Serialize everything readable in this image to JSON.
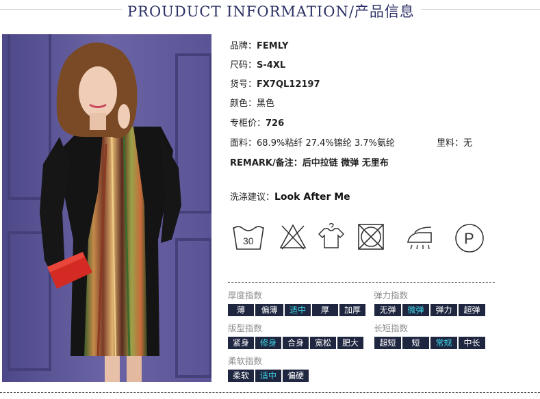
{
  "header": {
    "title": "PROUDUCT INFORMATION/产品信息"
  },
  "info": {
    "brand": {
      "label": "品牌：",
      "value": "FEMLY"
    },
    "size": {
      "label": "尺码：",
      "value": "S-4XL"
    },
    "sku": {
      "label": "货号：",
      "value": "FX7QL12197"
    },
    "color": {
      "label": "颜色：",
      "value": "黑色"
    },
    "price": {
      "label": "专柜价：",
      "value": "726"
    },
    "fabric": {
      "label": "面料：",
      "value": "68.9%粘纤 27.4%锦纶 3.7%氨纶"
    },
    "lining": {
      "label": "里料：",
      "value": "无"
    },
    "remark": {
      "label": "REMARK/备注：",
      "value": "后中拉链 微弹 无里布"
    },
    "wash": {
      "label": "洗涤建议：",
      "value": "Look After Me"
    }
  },
  "care_icons": [
    {
      "name": "wash-30-icon",
      "text": "30"
    },
    {
      "name": "no-bleach-icon"
    },
    {
      "name": "hang-dry-icon"
    },
    {
      "name": "no-tumble-dry-icon"
    },
    {
      "name": "iron-icon"
    },
    {
      "name": "dry-clean-p-icon",
      "text": "P"
    }
  ],
  "indices": {
    "thickness": {
      "title": "厚度指数",
      "options": [
        "薄",
        "偏薄",
        "适中",
        "厚",
        "加厚"
      ],
      "selected": "适中"
    },
    "elasticity": {
      "title": "弹力指数",
      "options": [
        "无弹",
        "微弹",
        "弹力",
        "超弹"
      ],
      "selected": "微弹"
    },
    "fit": {
      "title": "版型指数",
      "options": [
        "紧身",
        "修身",
        "合身",
        "宽松",
        "肥大"
      ],
      "selected": "修身"
    },
    "length": {
      "title": "长短指数",
      "options": [
        "超短",
        "短",
        "常规",
        "中长"
      ],
      "selected": "常规"
    },
    "softness": {
      "title": "柔软指数",
      "options": [
        "柔软",
        "适中",
        "偏硬"
      ],
      "selected": "适中"
    }
  },
  "colors": {
    "title": "#2c3166",
    "tag_bg": "#1f2640",
    "tag_text": "#ffffff",
    "tag_selected_text": "#3dd6e8",
    "group_title": "#8a8a8a"
  }
}
